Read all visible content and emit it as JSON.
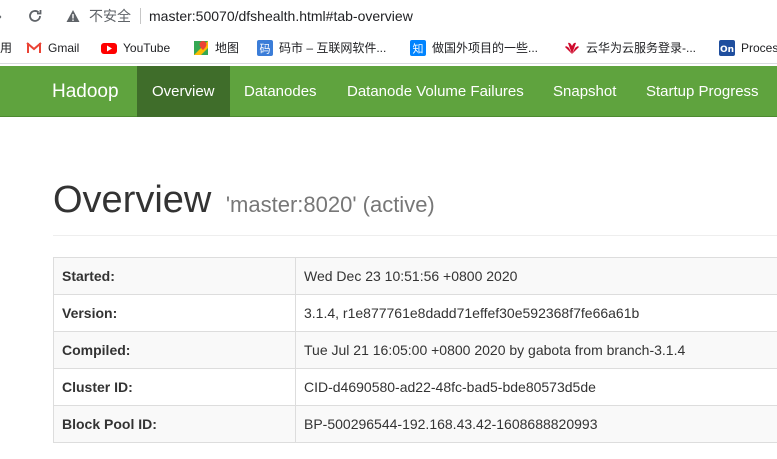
{
  "browser": {
    "security_label": "不安全",
    "url": "master:50070/dfshealth.html#tab-overview"
  },
  "bookmarks": {
    "apps_label": "用",
    "items": [
      {
        "label": "Gmail",
        "icon": "gmail-icon"
      },
      {
        "label": "YouTube",
        "icon": "youtube-icon"
      },
      {
        "label": "地图",
        "icon": "maps-icon"
      },
      {
        "label": "码市 – 互联网软件...",
        "icon": "mashi-icon"
      },
      {
        "label": "做国外项目的一些...",
        "icon": "zhihu-icon"
      },
      {
        "label": "云华为云服务登录-...",
        "icon": "huawei-icon"
      },
      {
        "label": "Proces",
        "icon": "on-icon"
      }
    ]
  },
  "navbar": {
    "brand": "Hadoop",
    "items": [
      {
        "label": "Overview",
        "active": true
      },
      {
        "label": "Datanodes",
        "active": false
      },
      {
        "label": "Datanode Volume Failures",
        "active": false
      },
      {
        "label": "Snapshot",
        "active": false
      },
      {
        "label": "Startup Progress",
        "active": false
      }
    ],
    "color": "#5fa33e",
    "active_color": "#3f6d2a"
  },
  "overview": {
    "title": "Overview",
    "host": "'master:8020' (active)",
    "rows": [
      {
        "key": "Started:",
        "value": "Wed Dec 23 10:51:56 +0800 2020"
      },
      {
        "key": "Version:",
        "value": "3.1.4, r1e877761e8dadd71effef30e592368f7fe66a61b"
      },
      {
        "key": "Compiled:",
        "value": "Tue Jul 21 16:05:00 +0800 2020 by gabota from branch-3.1.4"
      },
      {
        "key": "Cluster ID:",
        "value": "CID-d4690580-ad22-48fc-bad5-bde80573d5de"
      },
      {
        "key": "Block Pool ID:",
        "value": "BP-500296544-192.168.43.42-1608688820993"
      }
    ]
  }
}
